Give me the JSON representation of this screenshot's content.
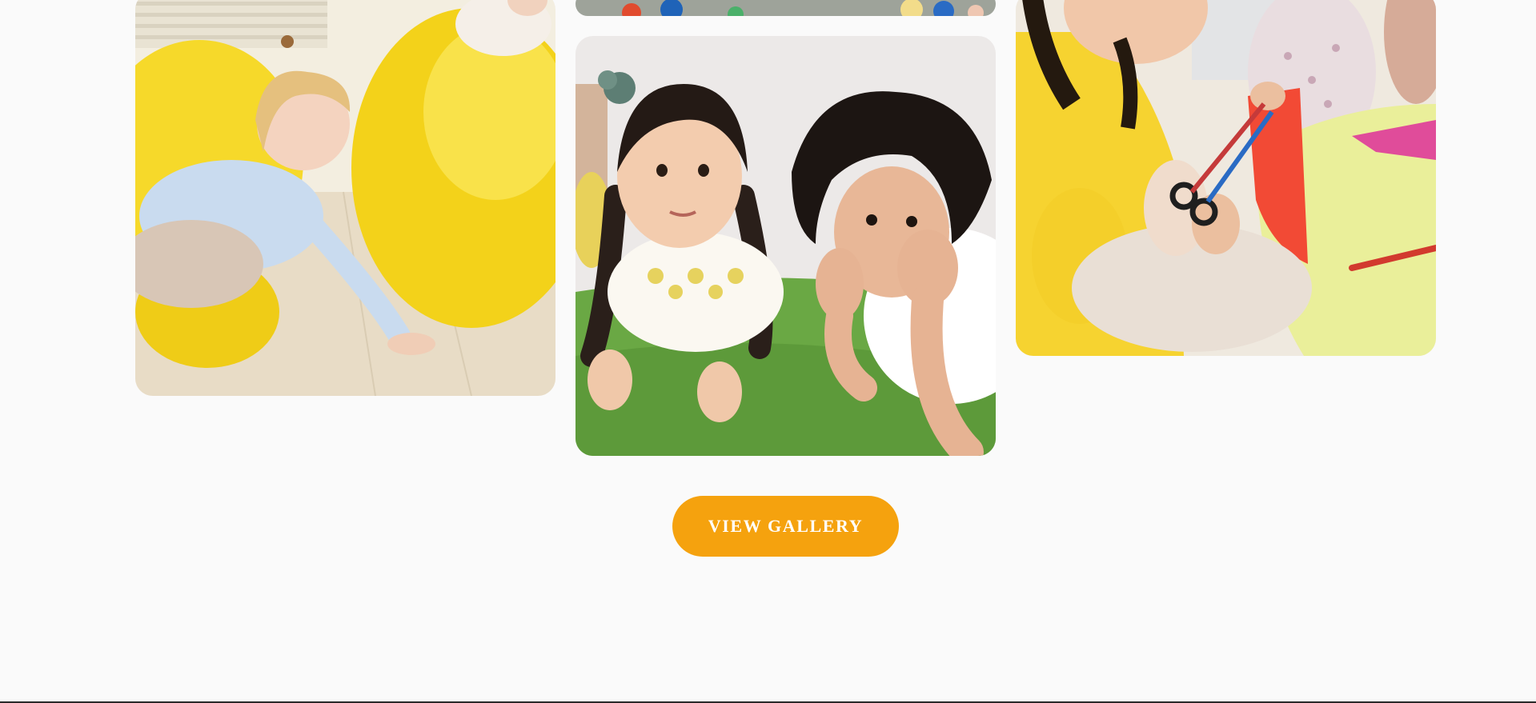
{
  "gallery": {
    "images": [
      {
        "name": "kids-yellow-beanbags-photo",
        "alt": ""
      },
      {
        "name": "ball-pit-photo",
        "alt": ""
      },
      {
        "name": "kids-lying-on-grass-photo",
        "alt": ""
      },
      {
        "name": "girl-cutting-paper-photo",
        "alt": ""
      }
    ],
    "button_label": "VIEW GALLERY"
  },
  "colors": {
    "page_background": "#fafafa",
    "button_background": "#f5a20e",
    "button_text": "#ffffff"
  }
}
